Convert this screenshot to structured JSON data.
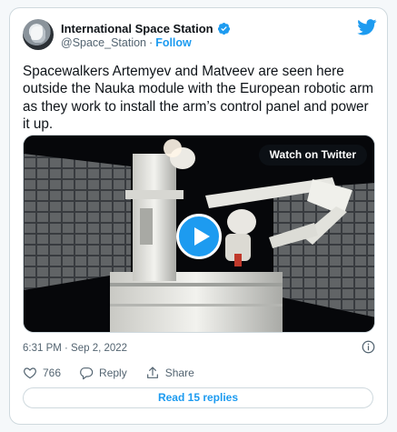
{
  "author": {
    "display_name": "International Space Station",
    "handle": "@Space_Station",
    "separator": "·",
    "follow_label": "Follow",
    "verified": true
  },
  "tweet": {
    "text": "Spacewalkers Artemyev and Matveev are seen here outside the Nauka module with the European robotic arm as they work to install the arm’s control panel and power it up.",
    "timestamp": "6:31 PM · Sep 2, 2022"
  },
  "media": {
    "watch_label": "Watch on Twitter",
    "type": "video"
  },
  "actions": {
    "like_count": "766",
    "reply_label": "Reply",
    "share_label": "Share"
  },
  "read_replies_label": "Read 15 replies",
  "colors": {
    "accent": "#1d9bf0",
    "text": "#0f1419",
    "secondary_text": "#536471",
    "border": "#cfd9de"
  },
  "icons": [
    "verified-badge-icon",
    "twitter-bird-icon",
    "play-icon",
    "info-icon",
    "heart-icon",
    "reply-icon",
    "share-icon"
  ]
}
